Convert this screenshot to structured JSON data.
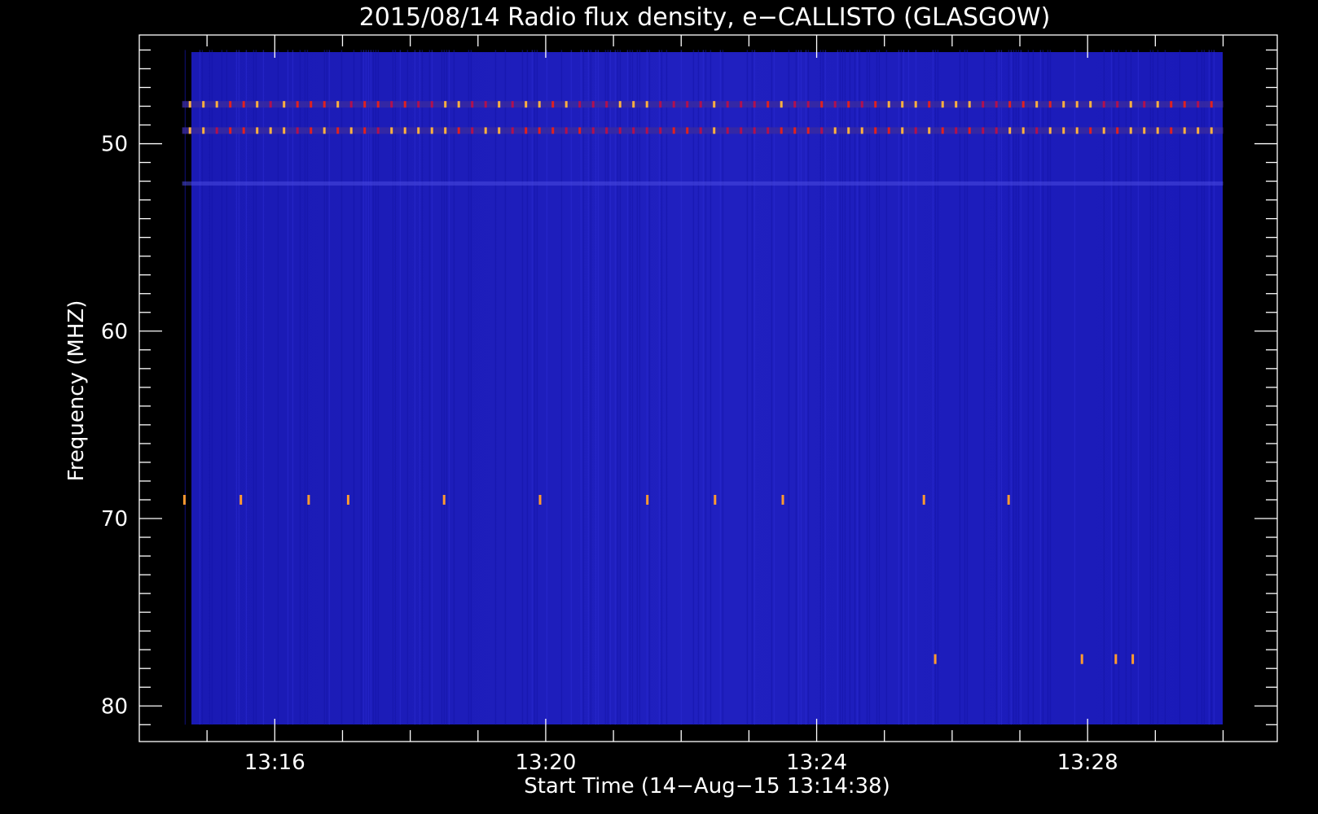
{
  "chart_data": {
    "type": "heatmap",
    "title": "2015/08/14  Radio flux density, e−CALLISTO (GLASGOW)",
    "xlabel": "Start Time (14−Aug−15 13:14:38)",
    "ylabel": "Frequency (MHZ)",
    "x_unit": "minutes",
    "x_range": [
      "13:14:38",
      "13:30:00"
    ],
    "xlim": [
      "13:14:00",
      "13:30:48"
    ],
    "x_ticks": [
      "13:16",
      "13:20",
      "13:24",
      "13:28"
    ],
    "y_unit": "MHz",
    "y_range": [
      45,
      81
    ],
    "ylim": [
      44.2,
      81.9
    ],
    "y_ticks": [
      50,
      60,
      70,
      80
    ],
    "y_inverted": true,
    "colormap": "blue-red-yellow",
    "background_level_color": "#1e1eb8",
    "features": [
      {
        "name": "interference band",
        "freq_mhz": 47.9,
        "pattern": "periodic bursts"
      },
      {
        "name": "interference band",
        "freq_mhz": 49.3,
        "pattern": "periodic bursts"
      },
      {
        "name": "weak band",
        "freq_mhz": 52.1,
        "pattern": "faint continuous"
      },
      {
        "name": "spikes",
        "freq_mhz": 69.0,
        "times": [
          "13:14:40",
          "13:15:30",
          "13:16:30",
          "13:17:05",
          "13:18:30",
          "13:19:55",
          "13:21:30",
          "13:22:30",
          "13:23:30",
          "13:25:35",
          "13:26:50"
        ]
      },
      {
        "name": "spikes",
        "freq_mhz": 77.5,
        "times": [
          "13:25:45",
          "13:27:55",
          "13:28:25",
          "13:28:40"
        ]
      }
    ]
  }
}
